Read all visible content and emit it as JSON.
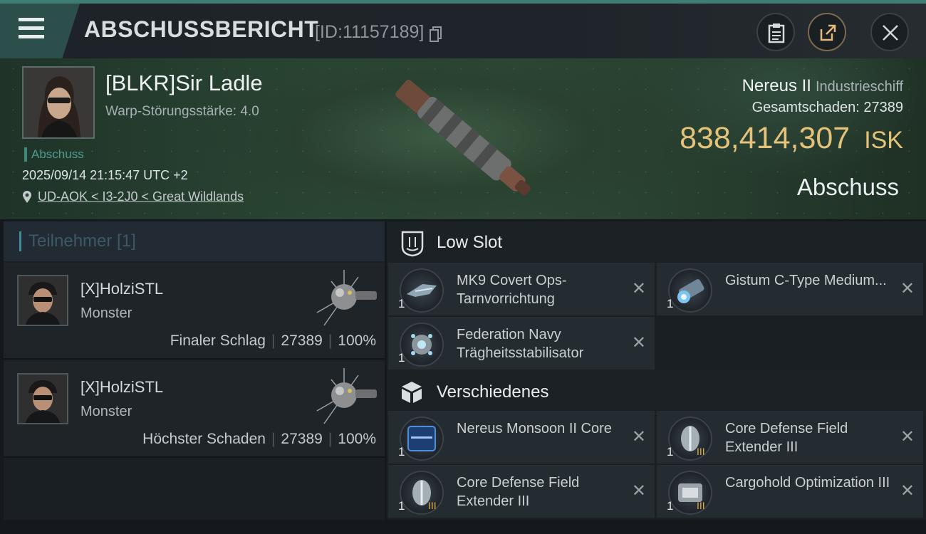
{
  "header": {
    "title": "ABSCHUSSBERICHT",
    "report_id": "[ID:11157189]",
    "menu_icon": "hamburger-icon",
    "clipboard_icon": "clipboard-icon",
    "share_icon": "share-icon",
    "close_icon": "close-icon"
  },
  "victim": {
    "name": "[BLKR]Sir Ladle",
    "warp_strength": "Warp-Störungsstärke: 4.0",
    "tag": "Abschuss",
    "datetime": "2025/09/14 21:15:47 UTC +2",
    "location": "UD-AOK < I3-2J0 < Great Wildlands",
    "ship_name": "Nereus II",
    "ship_class": "Industrieschiff",
    "total_damage_label": "Gesamtschaden:",
    "total_damage": "27389",
    "isk_value": "838,414,307",
    "isk_unit": "ISK",
    "result": "Abschuss"
  },
  "participants": {
    "header": "Teilnehmer [1]",
    "rows": [
      {
        "name": "[X]HolziSTL",
        "corp": "Monster",
        "role": "Finaler Schlag",
        "damage": "27389",
        "percent": "100%"
      },
      {
        "name": "[X]HolziSTL",
        "corp": "Monster",
        "role": "Höchster Schaden",
        "damage": "27389",
        "percent": "100%"
      }
    ]
  },
  "sections": {
    "low_slot": "Low Slot",
    "misc": "Verschiedenes"
  },
  "items": {
    "low": [
      {
        "qty": "1",
        "name": "MK9 Covert Ops-Tarnvorrichtung"
      },
      {
        "qty": "1",
        "name": "Gistum C-Type Medium..."
      },
      {
        "qty": "1",
        "name": "Federation Navy Trägheitsstabilisator"
      }
    ],
    "misc": [
      {
        "qty": "1",
        "name": "Nereus Monsoon II Core"
      },
      {
        "qty": "1",
        "name": "Core Defense Field Extender III"
      },
      {
        "qty": "1",
        "name": "Core Defense Field Extender III"
      },
      {
        "qty": "1",
        "name": "Cargohold Optimization III"
      }
    ]
  },
  "colors": {
    "accent_teal": "#3f7d74",
    "isk_gold": "#e5c27a",
    "panel": "#1a1f23"
  }
}
